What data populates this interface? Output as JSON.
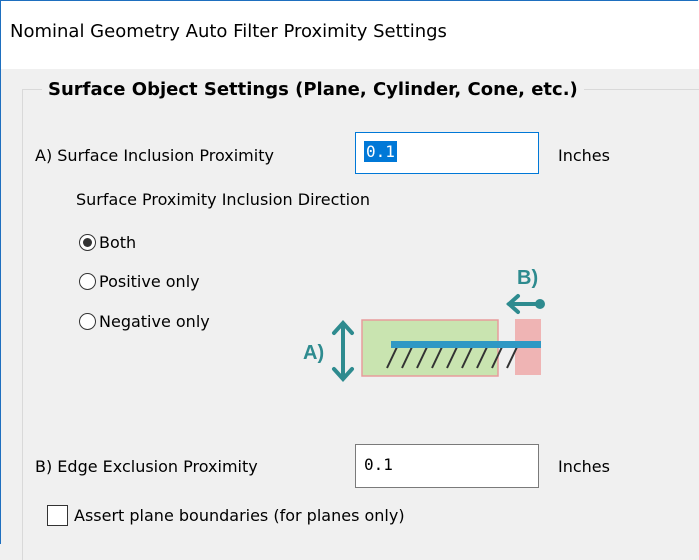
{
  "window": {
    "title": "Nominal Geometry Auto Filter Proximity Settings"
  },
  "group": {
    "title": "Surface Object Settings (Plane, Cylinder, Cone, etc.)"
  },
  "surface_inclusion": {
    "label": "A) Surface Inclusion Proximity",
    "value": "0.1",
    "unit": "Inches"
  },
  "direction": {
    "label": "Surface Proximity Inclusion Direction",
    "options": [
      {
        "label": "Both",
        "selected": true
      },
      {
        "label": "Positive only",
        "selected": false
      },
      {
        "label": "Negative only",
        "selected": false
      }
    ]
  },
  "diagram": {
    "label_a": "A)",
    "label_b": "B)",
    "accent_color": "#2e8b8f",
    "bar_color": "#2f98c4"
  },
  "edge_exclusion": {
    "label": "B) Edge Exclusion Proximity",
    "value": "0.1",
    "unit": "Inches"
  },
  "assert_planes": {
    "label": "Assert plane boundaries (for planes only)",
    "checked": false
  }
}
